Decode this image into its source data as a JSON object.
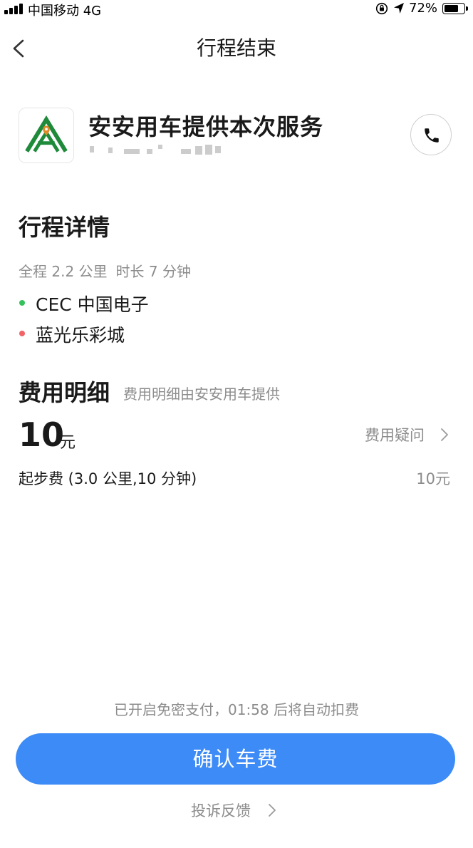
{
  "status_bar": {
    "carrier": "中国移动",
    "network": "4G",
    "battery": "72%",
    "battery_level": 0.72,
    "icons": [
      "signal-icon",
      "orientation-lock-icon",
      "location-arrow-icon",
      "battery-icon"
    ]
  },
  "nav": {
    "title": "行程结束",
    "back_icon": "chevron-left-icon"
  },
  "provider": {
    "name": "安安用车提供本次服务",
    "logo_icon": "anan-logo-icon",
    "call_icon": "phone-icon"
  },
  "trip": {
    "section_title": "行程详情",
    "distance": "全程 2.2 公里",
    "duration": "时长 7 分钟",
    "start": "CEC 中国电子",
    "end": "蓝光乐彩城",
    "start_dot_color": "#35c15b",
    "end_dot_color": "#f06467"
  },
  "fee": {
    "section_title": "费用明细",
    "note": "费用明细由安安用车提供",
    "amount": "10",
    "unit": "元",
    "query_label": "费用疑问",
    "line_label": "起步费 (3.0 公里,10 分钟)",
    "line_value": "10元"
  },
  "footer": {
    "auto_pay_note": "已开启免密支付，01:58  后将自动扣费",
    "confirm_label": "确认车费",
    "feedback_label": "投诉反馈",
    "accent_color": "#3d8bf7"
  }
}
